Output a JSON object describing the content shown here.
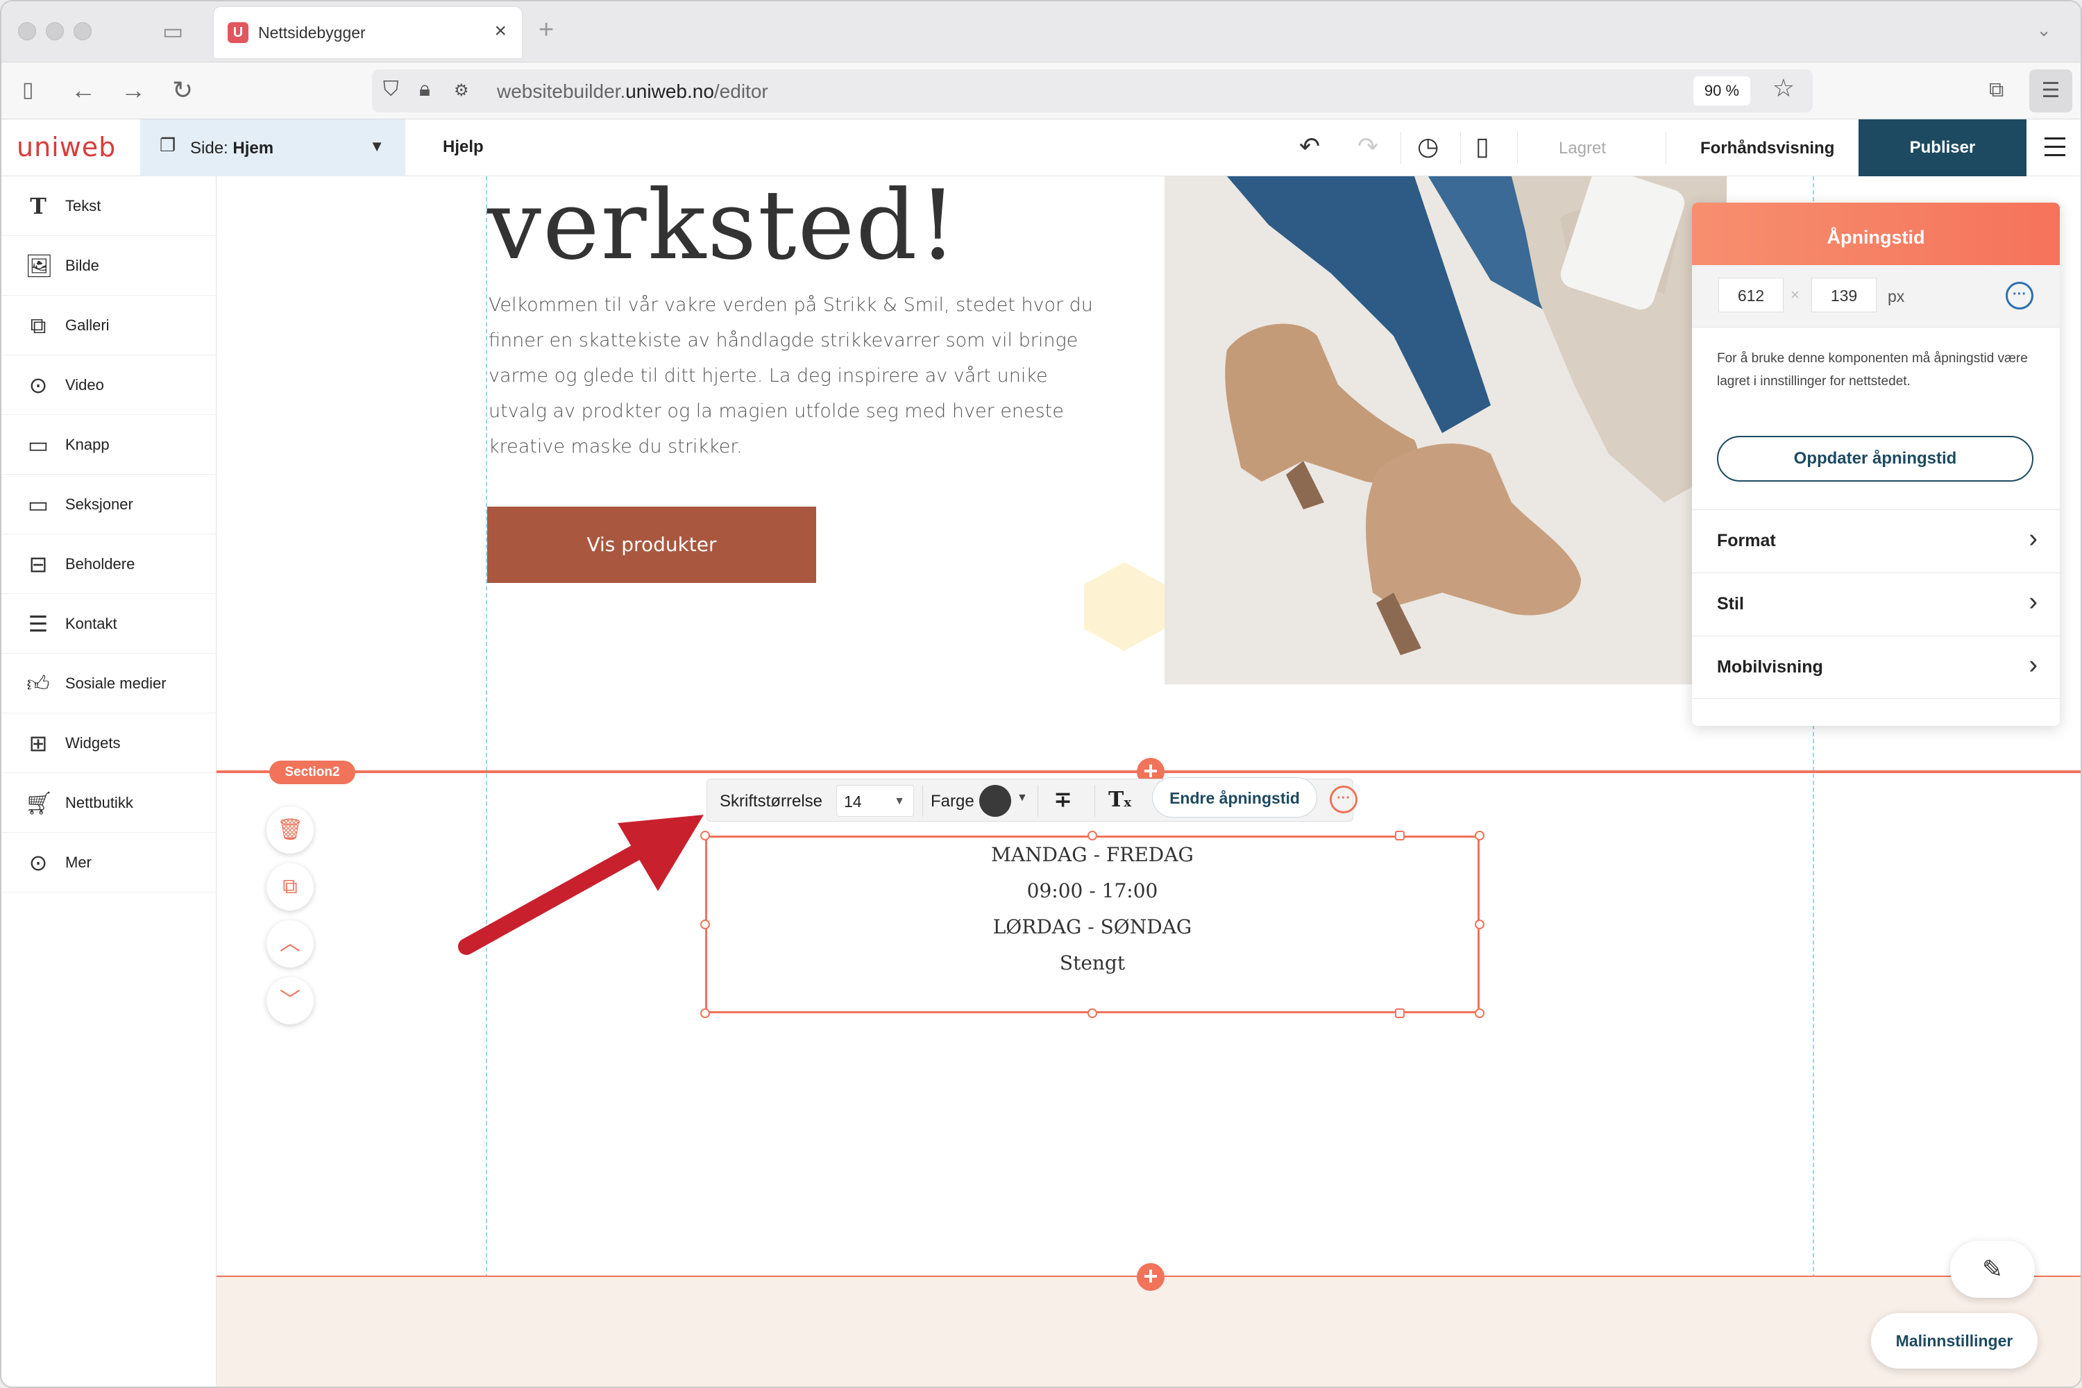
{
  "browser": {
    "tab_title": "Nettsidebygger",
    "tab_favicon": "U",
    "url_domain_prefix": "websitebuilder.",
    "url_domain": "uniweb.no",
    "url_path": "/editor",
    "zoom": "90 %"
  },
  "editor": {
    "logo": "uniweb",
    "page_label": "Side:",
    "page_name": "Hjem",
    "help": "Hjelp",
    "status": "Lagret",
    "preview": "Forhåndsvisning",
    "publish": "Publiser"
  },
  "sidebar": {
    "items": [
      {
        "label": "Tekst",
        "icon": "text-icon"
      },
      {
        "label": "Bilde",
        "icon": "image-icon"
      },
      {
        "label": "Galleri",
        "icon": "gallery-icon"
      },
      {
        "label": "Video",
        "icon": "video-icon"
      },
      {
        "label": "Knapp",
        "icon": "button-icon"
      },
      {
        "label": "Seksjoner",
        "icon": "section-icon"
      },
      {
        "label": "Beholdere",
        "icon": "container-icon"
      },
      {
        "label": "Kontakt",
        "icon": "contact-icon"
      },
      {
        "label": "Sosiale medier",
        "icon": "thumbs-up-icon"
      },
      {
        "label": "Widgets",
        "icon": "widgets-icon"
      },
      {
        "label": "Nettbutikk",
        "icon": "cart-icon"
      },
      {
        "label": "Mer",
        "icon": "more-icon"
      }
    ]
  },
  "canvas": {
    "headline": "verksted!",
    "intro": "Velkommen til vår vakre verden på Strikk & Smil, stedet hvor du finner en skattekiste av håndlagde strikkevarrer som vil bringe varme og glede til ditt hjerte. La deg inspirere av vårt unike utvalg av prodkter og la magien utfolde seg med hver eneste kreative maske du strikker.",
    "cta": "Vis produkter",
    "section_tag": "Section2",
    "hours": [
      "MANDAG - FREDAG",
      "09:00 - 17:00",
      "LØRDAG - SØNDAG",
      "Stengt"
    ]
  },
  "format_bar": {
    "font_size_label": "Skriftstørrelse",
    "font_size_value": "14",
    "color_label": "Farge",
    "color_value": "#3a3a3a",
    "edit_hours": "Endre åpningstid"
  },
  "panel": {
    "title": "Åpningstid",
    "width": "612",
    "height": "139",
    "unit": "px",
    "note": "For å bruke denne komponenten må åpningstid være lagret i innstillinger for nettstedet.",
    "update_button": "Oppdater åpningstid",
    "rows": [
      "Format",
      "Stil",
      "Mobilvisning"
    ]
  },
  "template_settings": "Malinnstillinger",
  "colors": {
    "accent": "#f0735a",
    "primary": "#1d4a60",
    "cta": "#a9583f"
  }
}
